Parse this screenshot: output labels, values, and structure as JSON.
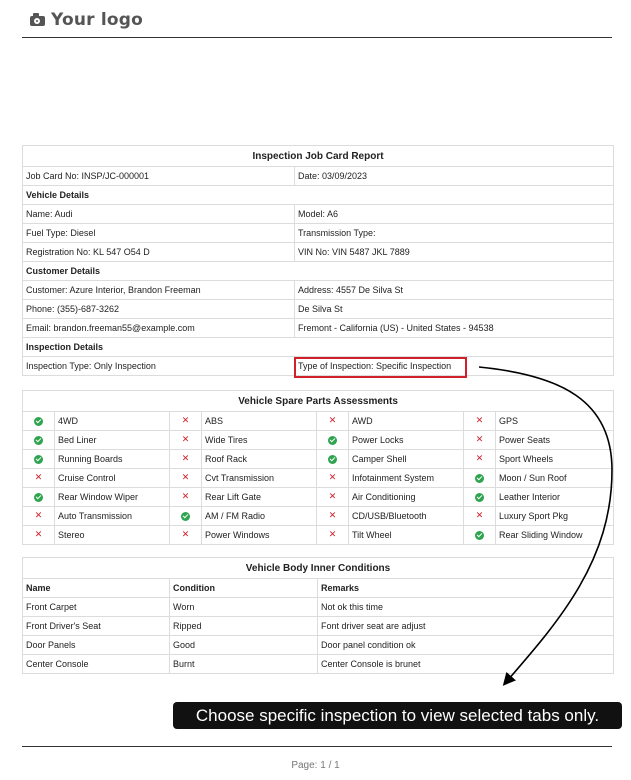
{
  "header": {
    "logo_text": "Your logo",
    "logo_icon": "camera-icon"
  },
  "job_card": {
    "title": "Inspection Job Card Report",
    "job_card_no": "Job Card No: INSP/JC-000001",
    "date": "Date: 03/09/2023",
    "vehicle_details_label": "Vehicle Details",
    "name": "Name: Audi",
    "model": "Model: A6",
    "fuel_type": "Fuel Type: Diesel",
    "transmission_type": "Transmission Type:",
    "registration_no": "Registration No: KL 547 O54 D",
    "vin_no": "VIN No: VIN 5487 JKL 7889",
    "customer_details_label": "Customer Details",
    "customer": "Customer: Azure Interior, Brandon Freeman",
    "address": "Address: 4557 De Silva St",
    "phone": "Phone: (355)-687-3262",
    "address_line2": "De Silva St",
    "email": "Email: brandon.freeman55@example.com",
    "address_line3": "Fremont - California (US) - United States - 94538",
    "inspection_details_label": "Inspection Details",
    "inspection_type": "Inspection Type: Only Inspection",
    "type_of_inspection": "Type of Inspection: Specific Inspection"
  },
  "spare_parts": {
    "title": "Vehicle Spare Parts Assessments",
    "rows": [
      [
        {
          "label": "4WD",
          "ok": true
        },
        {
          "label": "ABS",
          "ok": false
        },
        {
          "label": "AWD",
          "ok": false
        },
        {
          "label": "GPS",
          "ok": false
        }
      ],
      [
        {
          "label": "Bed Liner",
          "ok": true
        },
        {
          "label": "Wide Tires",
          "ok": false
        },
        {
          "label": "Power Locks",
          "ok": true
        },
        {
          "label": "Power Seats",
          "ok": false
        }
      ],
      [
        {
          "label": "Running Boards",
          "ok": true
        },
        {
          "label": "Roof Rack",
          "ok": false
        },
        {
          "label": "Camper Shell",
          "ok": true
        },
        {
          "label": "Sport Wheels",
          "ok": false
        }
      ],
      [
        {
          "label": "Cruise Control",
          "ok": false
        },
        {
          "label": "Cvt Transmission",
          "ok": false
        },
        {
          "label": "Infotainment System",
          "ok": false
        },
        {
          "label": "Moon / Sun Roof",
          "ok": true
        }
      ],
      [
        {
          "label": "Rear Window Wiper",
          "ok": true
        },
        {
          "label": "Rear Lift Gate",
          "ok": false
        },
        {
          "label": "Air Conditioning",
          "ok": false
        },
        {
          "label": "Leather Interior",
          "ok": true
        }
      ],
      [
        {
          "label": "Auto Transmission",
          "ok": false
        },
        {
          "label": "AM / FM Radio",
          "ok": true
        },
        {
          "label": "CD/USB/Bluetooth",
          "ok": false
        },
        {
          "label": "Luxury Sport Pkg",
          "ok": false
        }
      ],
      [
        {
          "label": "Stereo",
          "ok": false
        },
        {
          "label": "Power Windows",
          "ok": false
        },
        {
          "label": "Tilt Wheel",
          "ok": false
        },
        {
          "label": "Rear Sliding Window",
          "ok": true
        }
      ]
    ],
    "ok_icon": "check-circle-icon",
    "fail_icon": "cross-icon",
    "ok_color": "#2ea44f",
    "fail_color": "#d0202a"
  },
  "body_conditions": {
    "title": "Vehicle Body Inner Conditions",
    "columns": [
      "Name",
      "Condition",
      "Remarks"
    ],
    "rows": [
      [
        "Front Carpet",
        "Worn",
        "Not ok this time"
      ],
      [
        "Front Driver's Seat",
        "Ripped",
        "Font driver seat are adjust"
      ],
      [
        "Door Panels",
        "Good",
        "Door panel condition ok"
      ],
      [
        "Center Console",
        "Burnt",
        "Center Console is brunet"
      ]
    ]
  },
  "annotation": {
    "tooltip": "Choose specific inspection to view selected tabs only.",
    "highlight_color": "#d0202a"
  },
  "footer": {
    "page": "Page: 1 / 1"
  }
}
